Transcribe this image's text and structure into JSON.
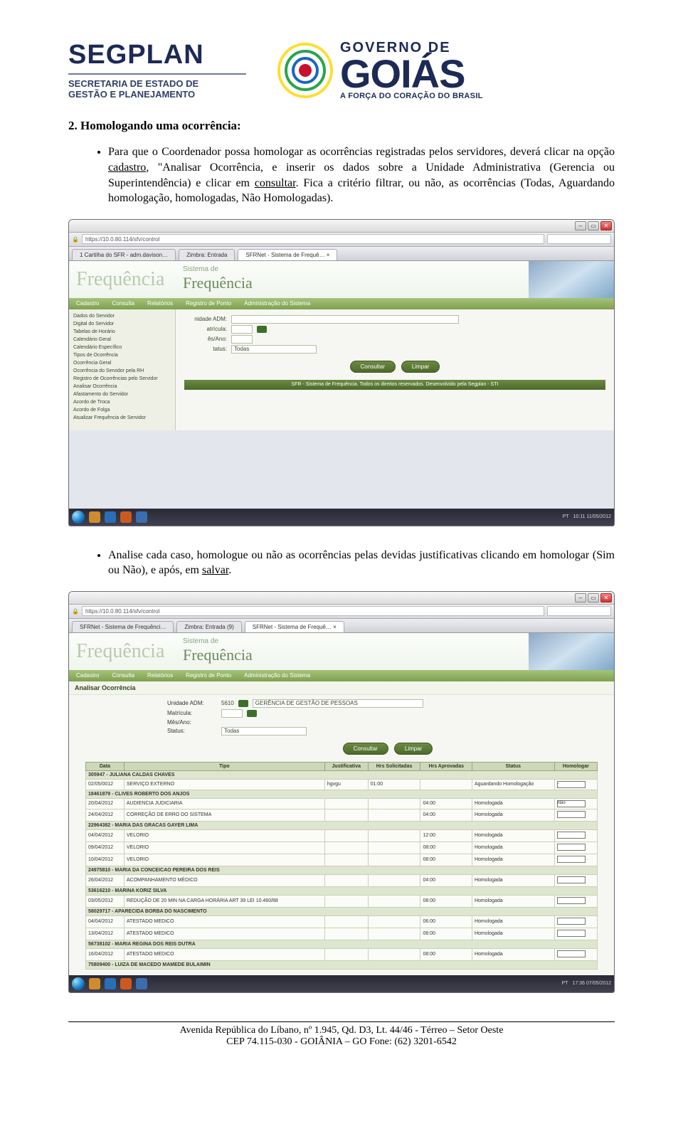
{
  "header": {
    "segplan": {
      "title": "SEGPLAN",
      "sub1": "SECRETARIA DE ESTADO DE",
      "sub2": "GESTÃO E PLANEJAMENTO"
    },
    "goias": {
      "line1": "GOVERNO DE",
      "line2": "GOIÁS",
      "slogan": "A FORÇA DO CORAÇÃO DO BRASIL"
    }
  },
  "section": {
    "title": "2.   Homologando uma ocorrência:"
  },
  "para": {
    "p1a": "Para que o Coordenador possa homologar as ocorrências registradas pelos servidores, deverá clicar na opção ",
    "p1_cadastro": "cadastro",
    "p1b": ", \"Analisar Ocorrência, e inserir os dados sobre a Unidade Administrativa (Gerencia ou Superintendência) e clicar em ",
    "p1_consultar": "consultar",
    "p1c": ". Fica a critério filtrar, ou não, as ocorrências (Todas, Aguardando homologação, homologadas, Não Homologadas).",
    "p2a": "Analise cada caso, homologue ou não as ocorrências pelas devidas justificativas clicando em homologar (Sim ou Não), e após, em ",
    "p2_salvar": "salvar",
    "p2b": "."
  },
  "sys": {
    "url": "https://10.0.80.114/sfv/control",
    "tabs": [
      "1 Cartilha do SFR - adm.davison…",
      "Zimbra: Entrada",
      "SFRNet - Sistema de Frequê… ×"
    ],
    "tabs2": [
      "SFRNet - Sistema de Frequênci…",
      "Zimbra: Entrada (9)",
      "SFRNet - Sistema de Frequê… ×"
    ],
    "brand": "Frequência",
    "sysline": "Sistema de",
    "brandword": "Frequência",
    "menu": [
      "Cadastro",
      "Consulta",
      "Relatórios",
      "Registro de Ponto",
      "Administração do Sistema"
    ],
    "side": [
      "Dados do Servidor",
      "Digital do Servidor",
      "Tabelas de Horário",
      "Calendário Geral",
      "Calendário Específico",
      "Tipos de Ocorrência",
      "Ocorrência Geral",
      "Ocorrência do Servidor pela RH",
      "Registro de Ocorrências pelo Servidor",
      "Analisar Ocorrência",
      "Afastamento do Servidor",
      "Acordo de Troca",
      "Acordo de Folga",
      "Atualizar Frequência de Servidor"
    ],
    "form1": {
      "l_unidade": "nidade ADM:",
      "l_matricula": "atrícula:",
      "l_mes": "ês/Ano:",
      "l_status": "tatus:",
      "status_val": "Todas"
    },
    "btn_consultar": "Consultar",
    "btn_limpar": "Limpar",
    "footer": "SFR - Sistema de Frequência. Todos os direitos reservados. Desenvolvido pela Segplan - STI",
    "time1": "10:11  11/05/2012",
    "time2": "17:36  07/05/2012"
  },
  "shot2": {
    "subtitle": "Analisar Ocorrência",
    "unidade_lbl": "Unidade ADM:",
    "unidade_val": "5610",
    "unidade_name": "GERÊNCIA DE GESTÃO DE PESSOAS",
    "matricula_lbl": "Matrícula:",
    "mes_lbl": "Mês/Ano:",
    "status_lbl": "Status:",
    "status_val": "Todas",
    "headers": [
      "Data",
      "Tipo",
      "Justificativa",
      "Hrs Solicitadas",
      "Hrs Aprovadas",
      "Status",
      "Homologar"
    ],
    "rows": [
      {
        "g": "305947 - JULIANA CALDAS CHAVES"
      },
      {
        "d": "02/05/0012",
        "t": "SERVIÇO EXTERNO",
        "j": "hgvgu",
        "hs": "01:00",
        "ha": "",
        "st": "Aguardando Homologação",
        "sel": "-"
      },
      {
        "g": "18461879 - CLIVES ROBERTO DOS ANJOS"
      },
      {
        "d": "20/04/2012",
        "t": "AUDIENCIA JUDICIARIA",
        "j": "",
        "hs": "",
        "ha": "04:00",
        "st": "Homologada",
        "sel": "Não"
      },
      {
        "d": "24/04/2012",
        "t": "CORREÇÃO DE ERRO DO SISTEMA",
        "j": "",
        "hs": "",
        "ha": "04:00",
        "st": "Homologada"
      },
      {
        "g": "22964382 - MARIA DAS GRACAS GAYER LIMA"
      },
      {
        "d": "04/04/2012",
        "t": "VELORIO",
        "j": "",
        "hs": "",
        "ha": "12:00",
        "st": "Homologada"
      },
      {
        "d": "09/04/2012",
        "t": "VELORIO",
        "j": "",
        "hs": "",
        "ha": "08:00",
        "st": "Homologada"
      },
      {
        "d": "10/04/2012",
        "t": "VELORIO",
        "j": "",
        "hs": "",
        "ha": "08:00",
        "st": "Homologada"
      },
      {
        "g": "24975810 - MARIA DA CONCEICAO PEREIRA DOS REIS"
      },
      {
        "d": "26/04/2012",
        "t": "ACOMPANHAMENTO MÉDICO",
        "j": "",
        "hs": "",
        "ha": "04:00",
        "st": "Homologada"
      },
      {
        "g": "53616210 - MARINA KORIZ SILVA"
      },
      {
        "d": "03/05/2012",
        "t": "REDUÇÃO DE 20 MIN NA CARGA HORÁRIA ART 39 LEI 10.460/88",
        "j": "",
        "hs": "",
        "ha": "08:00",
        "st": "Homologada"
      },
      {
        "g": "58029717 - APARECIDA BORBA DO NASCIMENTO"
      },
      {
        "d": "04/04/2012",
        "t": "ATESTADO MEDICO",
        "j": "",
        "hs": "",
        "ha": "06:00",
        "st": "Homologada"
      },
      {
        "d": "13/04/2012",
        "t": "ATESTADO MEDICO",
        "j": "",
        "hs": "",
        "ha": "06:00",
        "st": "Homologada"
      },
      {
        "g": "56738102 - MARIA REGINA DOS REIS DUTRA"
      },
      {
        "d": "16/04/2012",
        "t": "ATESTADO MEDICO",
        "j": "",
        "hs": "",
        "ha": "08:00",
        "st": "Homologada"
      },
      {
        "g": "75809400 - LUIZA DE MACEDO MAMEDE BULAIMIN"
      }
    ]
  },
  "footer": {
    "line1": "Avenida República do Líbano, nº 1.945, Qd. D3, Lt. 44/46 - Térreo – Setor Oeste",
    "line2": "CEP 74.115-030 - GOIÂNIA – GO Fone: (62) 3201-6542"
  }
}
